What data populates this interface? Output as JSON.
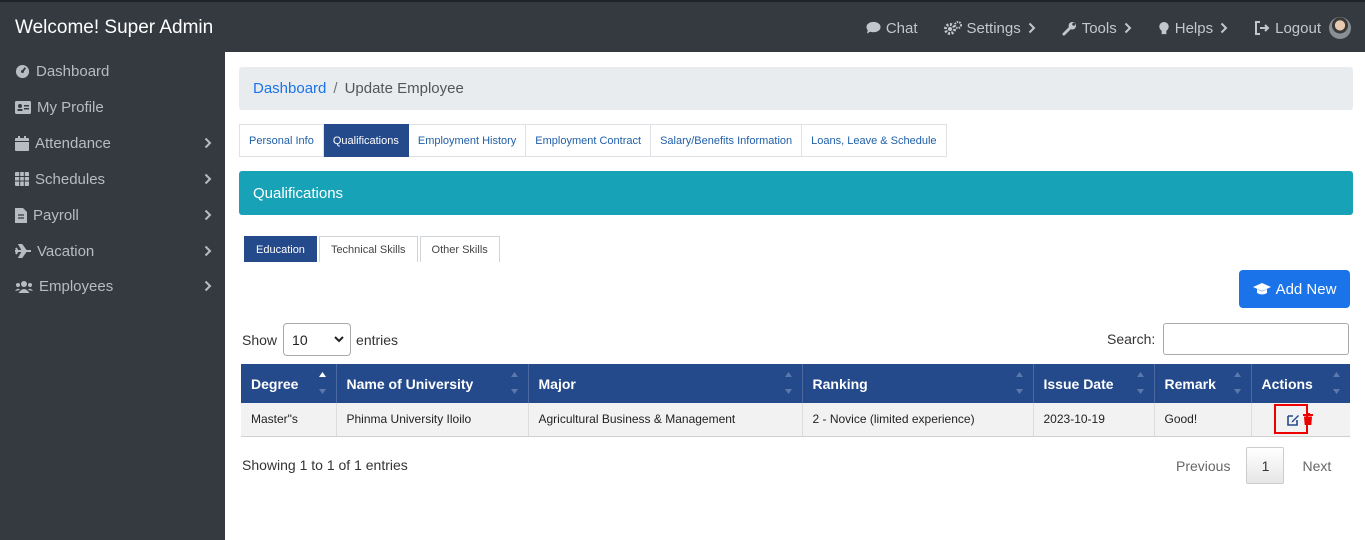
{
  "header": {
    "brand": "Welcome! Super Admin",
    "nav": [
      {
        "label": "Chat",
        "icon": "chat-icon"
      },
      {
        "label": "Settings",
        "icon": "cogs-icon"
      },
      {
        "label": "Tools",
        "icon": "wrench-icon"
      },
      {
        "label": "Helps",
        "icon": "lightbulb-icon"
      },
      {
        "label": "Logout",
        "icon": "logout-icon"
      }
    ]
  },
  "sidebar": {
    "items": [
      {
        "label": "Dashboard",
        "icon": "dashboard-icon"
      },
      {
        "label": "My Profile",
        "icon": "id-card-icon"
      },
      {
        "label": "Attendance",
        "icon": "calendar-icon"
      },
      {
        "label": "Schedules",
        "icon": "table-icon"
      },
      {
        "label": "Payroll",
        "icon": "file-icon"
      },
      {
        "label": "Vacation",
        "icon": "plane-icon"
      },
      {
        "label": "Employees",
        "icon": "users-icon"
      }
    ]
  },
  "breadcrumb": {
    "home": "Dashboard",
    "separator": "/",
    "current": "Update Employee"
  },
  "tabs": [
    "Personal Info",
    "Qualifications",
    "Employment History",
    "Employment Contract",
    "Salary/Benefits Information",
    "Loans, Leave & Schedule"
  ],
  "section": {
    "title": "Qualifications"
  },
  "subtabs": [
    "Education",
    "Technical Skills",
    "Other Skills"
  ],
  "add_button": {
    "label": "Add New"
  },
  "table_controls": {
    "show_label": "Show",
    "entries_value": "10",
    "entries_label": "entries",
    "search_label": "Search:"
  },
  "table": {
    "columns": [
      "Degree",
      "Name of University",
      "Major",
      "Ranking",
      "Issue Date",
      "Remark",
      "Actions"
    ],
    "rows": [
      [
        "Master\"s",
        "Phinma University Iloilo",
        "Agricultural Business & Management",
        "2 - Novice (limited experience)",
        "2023-10-19",
        "Good!"
      ]
    ]
  },
  "footer": {
    "info": "Showing 1 to 1 of 1 entries",
    "previous": "Previous",
    "page": "1",
    "next": "Next"
  },
  "colors": {
    "topbar": "#343a40",
    "accent": "#244a8b",
    "card_header": "#17a2b8",
    "primary_button": "#1a73e8",
    "highlight": "#ee0000"
  }
}
